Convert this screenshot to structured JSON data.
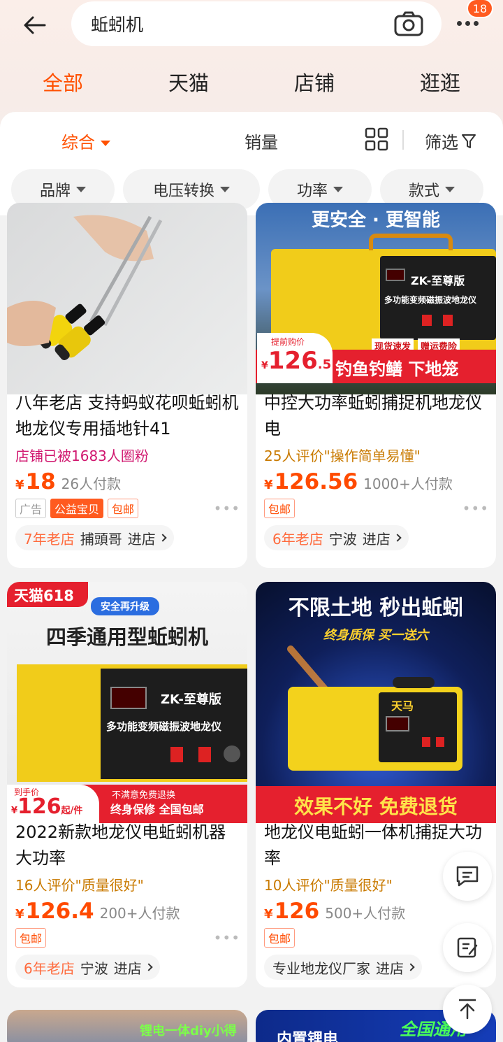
{
  "search": {
    "query": "蚯蚓机",
    "badge": "18"
  },
  "top_tabs": [
    "全部",
    "天猫",
    "店铺",
    "逛逛"
  ],
  "sort": {
    "comprehensive": "综合",
    "sales": "销量",
    "filter": "筛选"
  },
  "chips": [
    "品牌",
    "电压转换",
    "功率",
    "款式"
  ],
  "products": [
    {
      "title": "八年老店 支持蚂蚁花呗蚯蚓机地龙仪专用插地针41",
      "subtitle": "店铺已被1683人圈粉",
      "yen": "¥",
      "price": "18",
      "sold": "26人付款",
      "tags": [
        "广告",
        "公益宝贝",
        "包邮"
      ],
      "shop_age": "7年老店",
      "shop_name": "捕頭哥",
      "enter": "进店"
    },
    {
      "title": "中控大功率蚯蚓捕捉机地龙仪电",
      "subtitle": "25人评价\"操作简单易懂\"",
      "yen": "¥",
      "price": "126.56",
      "sold": "1000+人付款",
      "tags": [
        "包邮"
      ],
      "shop_age": "6年老店",
      "shop_name": "宁波",
      "enter": "进店",
      "image_texts": {
        "headline": "更安全 · 更智能",
        "panel_brand": "ZK-至尊版",
        "panel_desc": "多功能变频磁振波地龙仪",
        "promo1": "现货速发",
        "promo2": "赠运费险",
        "early_price_label": "提前购价",
        "image_price": "126",
        "image_price_dec": ".5",
        "banner": "钓鱼钓鳝 下地笼"
      }
    },
    {
      "title": "2022新款地龙仪电蚯蚓机器大功率",
      "subtitle": "16人评价\"质量很好\"",
      "yen": "¥",
      "price": "126.4",
      "sold": "200+人付款",
      "tags": [
        "包邮"
      ],
      "shop_age": "6年老店",
      "shop_name": "宁波",
      "enter": "进店",
      "image_texts": {
        "tmall": "天猫618",
        "upgrade": "安全再升级",
        "headline": "四季通用型蚯蚓机",
        "panel_brand": "ZK-至尊版",
        "panel_desc": "多功能变频磁振波地龙仪",
        "arrival_label": "到手价",
        "image_price": "126",
        "image_price_unit": "起/件",
        "refund": "不满意免费退换",
        "warranty": "终身保修 全国包邮"
      }
    },
    {
      "title": "地龙仪电蚯蚓一体机捕捉大功率",
      "subtitle": "10人评价\"质量很好\"",
      "yen": "¥",
      "price": "126",
      "sold": "500+人付款",
      "tags": [
        "包邮"
      ],
      "shop_age": "",
      "shop_name": "专业地龙仪厂家",
      "enter": "进店",
      "image_texts": {
        "headline": "不限土地 秒出蚯蚓",
        "slogan": "终身质保 买一送六",
        "brand": "天马",
        "banner": "效果不好 免费退货"
      }
    }
  ],
  "bottom_peek": {
    "left": "锂电一体diy小得",
    "right1": "内置锂电",
    "right2": "全国通用"
  },
  "colors": {
    "accent": "#ff5000",
    "price": "#ff4a00",
    "tmall_red": "#e5202e"
  },
  "icons": [
    "back-arrow-icon",
    "camera-icon",
    "more-icon",
    "grid-view-icon",
    "filter-icon",
    "chat-icon",
    "edit-icon",
    "back-to-top-icon"
  ]
}
